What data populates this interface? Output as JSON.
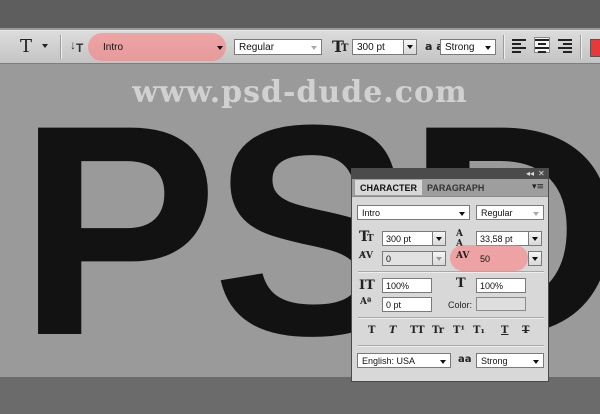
{
  "watermark": "www.psd-dude.com",
  "canvas_text": "PSD",
  "options_bar": {
    "tool_icon": "T",
    "font_family": "Intro",
    "font_style": "Regular",
    "font_size": "300 pt",
    "aa_label": "a a",
    "antialias": "Strong",
    "text_color": "#e8383a"
  },
  "panel": {
    "tabs": [
      "CHARACTER",
      "PARAGRAPH"
    ],
    "font_family": "Intro",
    "font_style": "Regular",
    "font_size": "300 pt",
    "leading": "33,58 pt",
    "kerning": "0",
    "tracking": "50",
    "vertical_scale": "100%",
    "horizontal_scale": "100%",
    "baseline_shift": "0 pt",
    "color_label": "Color:",
    "style_buttons": [
      "T",
      "T",
      "TT",
      "Tr",
      "T¹",
      "T₁",
      "T",
      "T"
    ],
    "language": "English: USA",
    "antialias": "Strong"
  },
  "highlight_color": "#ff7878"
}
